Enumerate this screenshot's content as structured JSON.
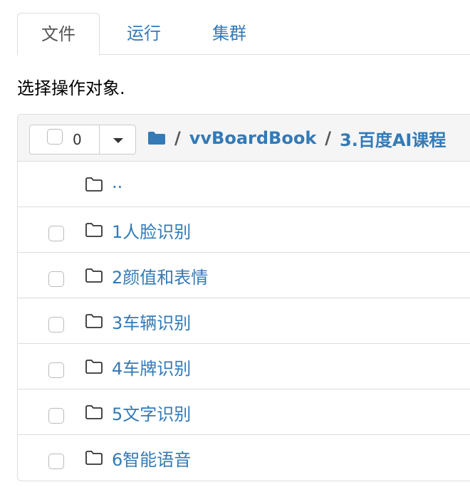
{
  "tabs": [
    {
      "label": "文件",
      "active": true
    },
    {
      "label": "运行",
      "active": false
    },
    {
      "label": "集群",
      "active": false
    }
  ],
  "instruction": "选择操作对象.",
  "selector": {
    "count": "0"
  },
  "breadcrumb": {
    "separator": "/",
    "items": [
      "vvBoardBook",
      "3.百度AI课程"
    ]
  },
  "rows": [
    {
      "label": "..",
      "has_checkbox": false
    },
    {
      "label": "1人脸识别",
      "has_checkbox": true
    },
    {
      "label": "2颜值和表情",
      "has_checkbox": true
    },
    {
      "label": "3车辆识别",
      "has_checkbox": true
    },
    {
      "label": "4车牌识别",
      "has_checkbox": true
    },
    {
      "label": "5文字识别",
      "has_checkbox": true
    },
    {
      "label": "6智能语音",
      "has_checkbox": true
    }
  ],
  "colors": {
    "link": "#337ab7",
    "border": "#dddddd",
    "header_bg": "#f5f5f5"
  }
}
